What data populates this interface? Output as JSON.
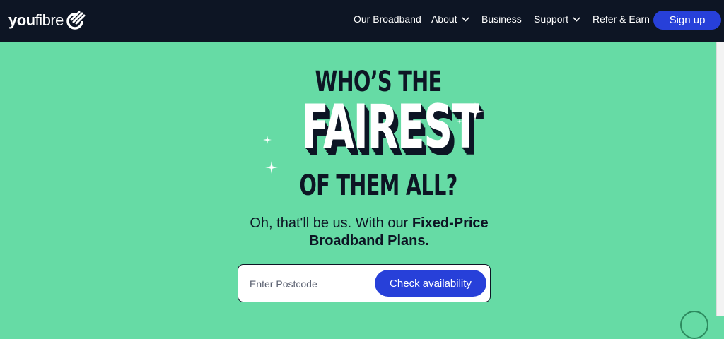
{
  "header": {
    "logo_you": "you",
    "logo_fibre": "fibre",
    "nav": [
      {
        "label": "Our Broadband",
        "has_dropdown": false
      },
      {
        "label": "About",
        "has_dropdown": true
      },
      {
        "label": "Business",
        "has_dropdown": false
      },
      {
        "label": "Support",
        "has_dropdown": true
      },
      {
        "label": "Refer & Earn",
        "has_dropdown": false
      }
    ],
    "signup_label": "Sign up"
  },
  "hero": {
    "line1": "WHO’S THE",
    "line2": "FAIREST",
    "line3": "OF THEM ALL?",
    "tagline_part1": "Oh, that'll be us. With our ",
    "tagline_bold1": "Fixed-Price",
    "tagline_bold2": "Broadband Plans."
  },
  "postcode": {
    "placeholder": "Enter Postcode",
    "value": "",
    "button_label": "Check availability"
  },
  "colors": {
    "background": "#66dba5",
    "header": "#0d1524",
    "accent": "#2740d9",
    "text": "#0d1524"
  }
}
